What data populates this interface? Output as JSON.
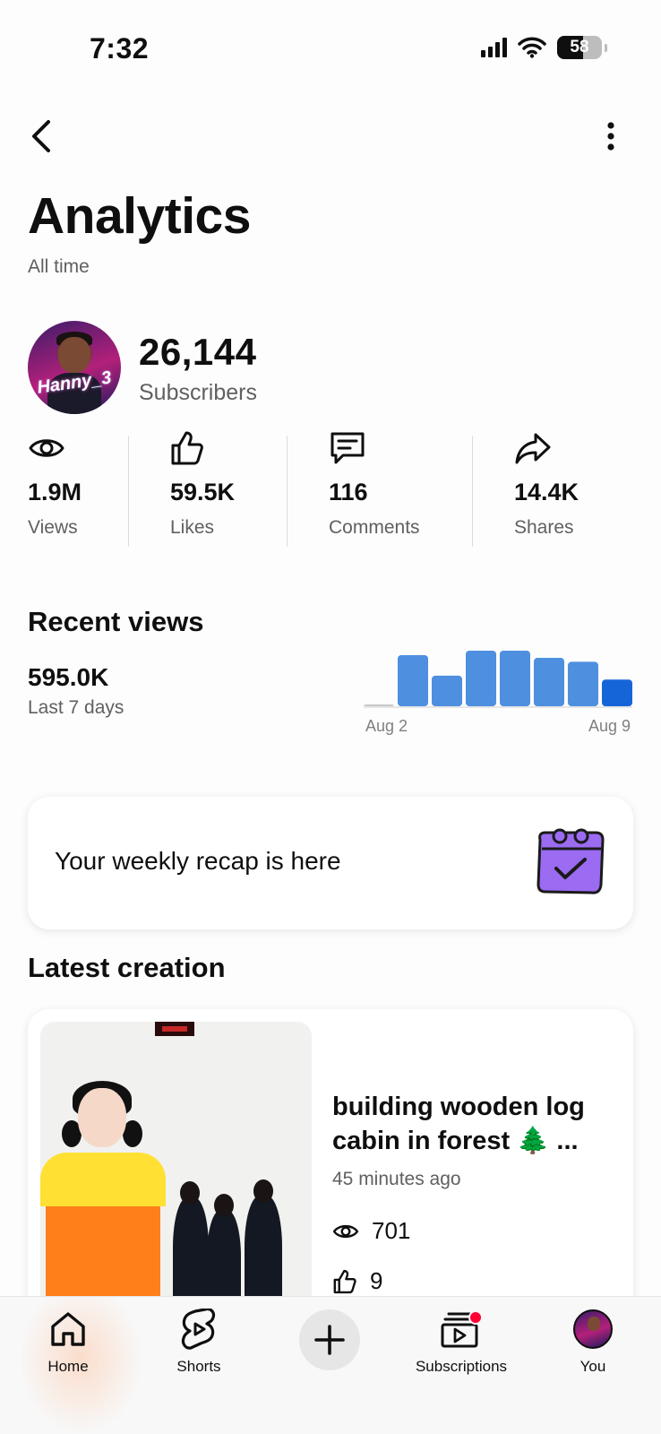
{
  "status_bar": {
    "time": "7:32",
    "battery": "58",
    "battery_level": 0.58
  },
  "header": {
    "title": "Analytics",
    "subtitle": "All time"
  },
  "channel": {
    "avatar_text": "Hanny_3",
    "subscriber_count": "26,144",
    "subscriber_label": "Subscribers"
  },
  "metrics": [
    {
      "icon": "eye-icon",
      "value": "1.9M",
      "label": "Views"
    },
    {
      "icon": "thumbs-up-icon",
      "value": "59.5K",
      "label": "Likes"
    },
    {
      "icon": "comment-icon",
      "value": "116",
      "label": "Comments"
    },
    {
      "icon": "share-icon",
      "value": "14.4K",
      "label": "Shares"
    }
  ],
  "recent_views": {
    "title": "Recent views",
    "value": "595.0K",
    "label": "Last 7 days"
  },
  "chart_data": {
    "type": "bar",
    "categories": [
      "Aug 2",
      "Aug 3",
      "Aug 4",
      "Aug 5",
      "Aug 6",
      "Aug 7",
      "Aug 8",
      "Aug 9"
    ],
    "values": [
      2,
      92,
      55,
      100,
      100,
      87,
      80,
      48
    ],
    "tick_labels": [
      "Aug 2",
      "Aug 9"
    ],
    "colors": {
      "bar": "#4e8fe0",
      "highlight": "#1565d8",
      "empty": "#c7c7c7"
    },
    "grid": false
  },
  "recap": {
    "text": "Your weekly recap is here",
    "icon": "calendar-check-icon"
  },
  "latest": {
    "title": "Latest creation",
    "video_title": "building wooden log cabin in forest 🌲 ...",
    "age": "45 minutes ago",
    "views": "701",
    "likes": "9"
  },
  "bottom_nav": {
    "home": "Home",
    "shorts": "Shorts",
    "subscriptions": "Subscriptions",
    "you": "You"
  },
  "colors": {
    "accent_red": "#ff0033",
    "text_secondary": "#606060"
  }
}
